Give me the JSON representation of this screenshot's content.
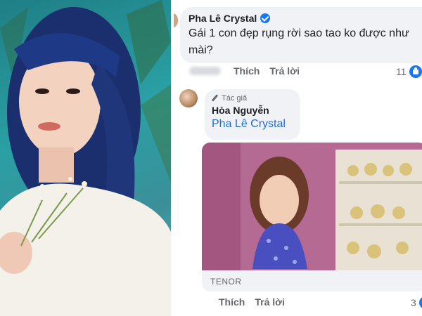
{
  "comment": {
    "author": "Pha Lê Crystal",
    "verified_icon": "verified-badge-icon",
    "text": "Gái 1 con đẹp rụng rời sao tao ko được như mài?",
    "actions": {
      "like": "Thích",
      "reply": "Trả lời"
    },
    "reaction_count": "11",
    "reaction_icon": "like-icon"
  },
  "reply": {
    "badge": "Tác giả",
    "badge_icon": "pen-icon",
    "author": "Hòa Nguyễn",
    "mention": "Pha Lê Crystal",
    "attachment_source": "TENOR",
    "actions": {
      "like": "Thích",
      "reply": "Trả lời"
    },
    "reaction_count": "3",
    "reaction_icon": "like-icon"
  },
  "colors": {
    "bubble": "#f0f2f5",
    "link": "#216fdb",
    "facebook_blue": "#1877f2",
    "muted": "#65676b"
  }
}
